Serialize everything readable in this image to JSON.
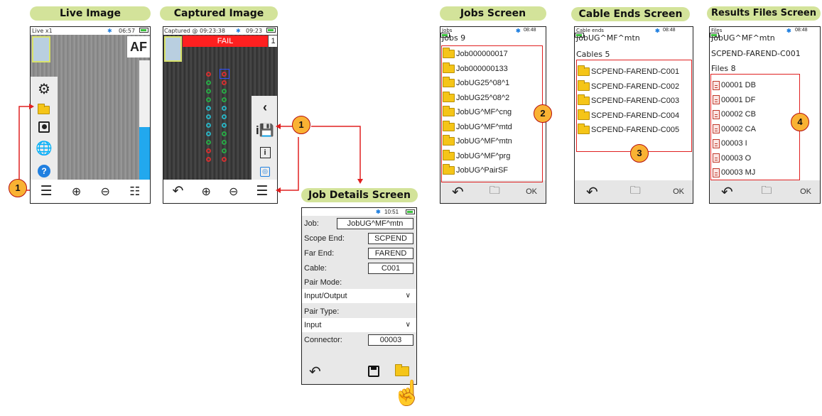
{
  "titles": {
    "live": "Live Image",
    "captured": "Captured Image",
    "jobs": "Jobs Screen",
    "cable_ends": "Cable Ends Screen",
    "results": "Results Files Screen",
    "job_details": "Job Details Screen"
  },
  "live_screen": {
    "mode": "Live x1",
    "time": "06:57",
    "af_label": "AF",
    "side_icons": [
      "gear-icon",
      "folder-icon",
      "record-icon",
      "globe-icon",
      "help-icon"
    ],
    "bottom_icons": [
      "menu-icon",
      "zoom-in-icon",
      "zoom-out-icon",
      "settings-sliders-icon"
    ],
    "level_fraction": 0.45
  },
  "captured_screen": {
    "caption": "Captured @ 09:23:38",
    "time": "09:23",
    "result": "FAIL",
    "count": "1",
    "side_icons": [
      "share-icon",
      "save-details-icon",
      "info-icon",
      "target-icon"
    ],
    "bottom_icons": [
      "back-icon",
      "zoom-in-icon",
      "zoom-out-icon",
      "menu-icon"
    ]
  },
  "jobs_screen": {
    "caption": "Jobs",
    "header": "Jobs 9",
    "time": "08:48",
    "items": [
      "Job000000017",
      "Job000000133",
      "JobUG25^08^1",
      "JobUG25^08^2",
      "JobUG^MF^cng",
      "JobUG^MF^mtd",
      "JobUG^MF^mtn",
      "JobUG^MF^prg",
      "JobUG^PairSF"
    ],
    "ok": "OK"
  },
  "cable_screen": {
    "caption": "Cable ends",
    "job": "JobUG^MF^mtn",
    "header": "Cables 5",
    "time": "08:48",
    "items": [
      "SCPEND-FAREND-C001",
      "SCPEND-FAREND-C002",
      "SCPEND-FAREND-C003",
      "SCPEND-FAREND-C004",
      "SCPEND-FAREND-C005"
    ],
    "ok": "OK"
  },
  "files_screen": {
    "caption": "Files",
    "job": "JobUG^MF^mtn",
    "cable": "SCPEND-FAREND-C001",
    "header": "Files 8",
    "time": "08:48",
    "items": [
      "00001 DB",
      "00001 DF",
      "00002 CB",
      "00002 CA",
      "00003 I",
      "00003 O",
      "00003 MJ"
    ],
    "ok": "OK"
  },
  "details_screen": {
    "time": "10:51",
    "job_label": "Job:",
    "job_value": "JobUG^MF^mtn",
    "scope_label": "Scope End:",
    "scope_value": "SCPEND",
    "far_label": "Far End:",
    "far_value": "FAREND",
    "cable_label": "Cable:",
    "cable_value": "C001",
    "pair_mode_label": "Pair Mode:",
    "pair_mode_value": "Input/Output",
    "pair_type_label": "Pair Type:",
    "pair_type_value": "Input",
    "connector_label": "Connector:",
    "connector_value": "00003"
  },
  "badges": [
    "1",
    "1",
    "2",
    "3",
    "4"
  ],
  "colors": {
    "title_bg": "#d3e39a",
    "fail_red": "#ff2020",
    "badge_fill": "#f9b233",
    "callout_red": "#e02020",
    "bluetooth": "#1f7fe0"
  }
}
